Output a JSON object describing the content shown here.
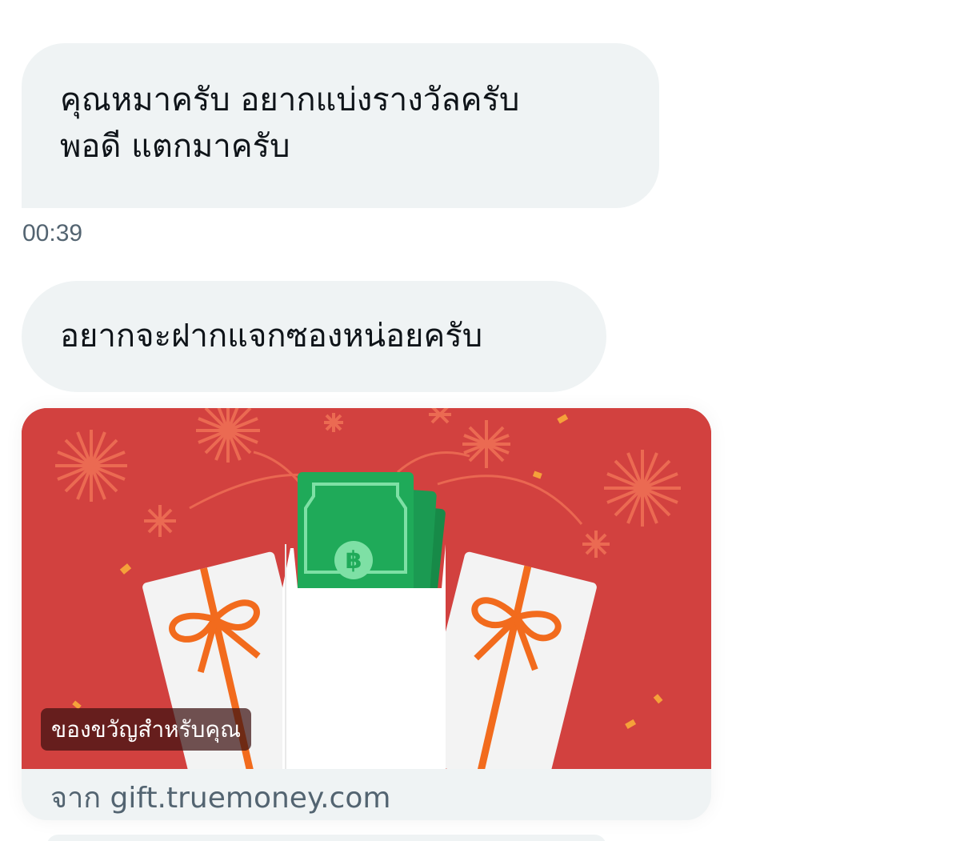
{
  "messages": [
    {
      "lines": [
        "คุณหมาครับ อยากแบ่งรางวัลครับ",
        "พอดี แตกมาครับ"
      ]
    },
    {
      "lines": [
        "อยากจะฝากแจกซองหน่อยครับ"
      ]
    }
  ],
  "timestamp": "00:39",
  "gift_card": {
    "overlay_label": "ของขวัญสำหรับคุณ",
    "source": "จาก gift.truemoney.com",
    "colors": {
      "background": "#d2413f",
      "banknote": "#1faa59",
      "ribbon": "#f26b1d"
    }
  }
}
